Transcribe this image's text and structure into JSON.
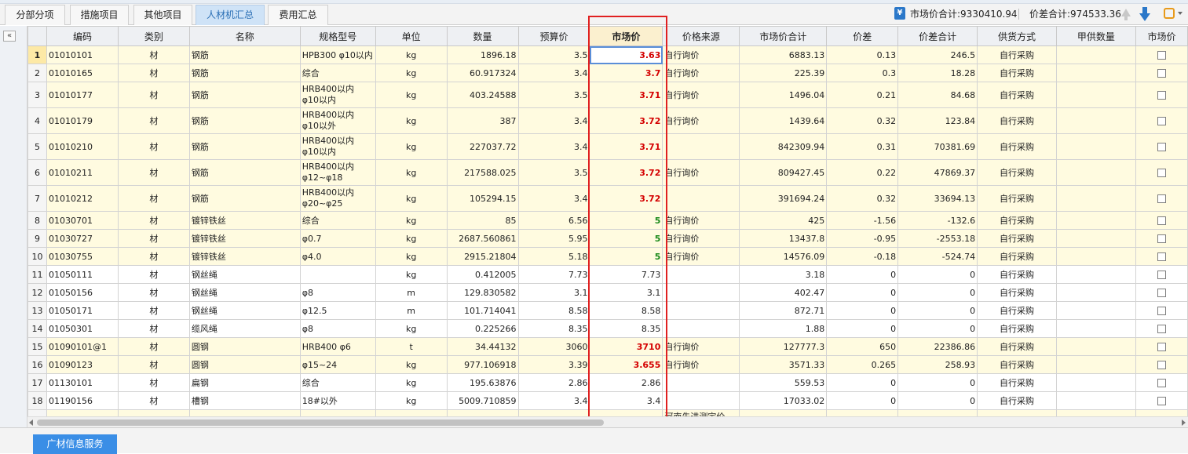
{
  "tabs": [
    {
      "label": "分部分项",
      "active": false
    },
    {
      "label": "措施项目",
      "active": false
    },
    {
      "label": "其他项目",
      "active": false
    },
    {
      "label": "人材机汇总",
      "active": true
    },
    {
      "label": "费用汇总",
      "active": false
    }
  ],
  "summary": {
    "market_total": "市场价合计:9330410.94",
    "diff_total": "价差合计:974533.36"
  },
  "icons": {
    "money": "money-icon",
    "move_up": "arrow-up-icon",
    "move_down": "arrow-down-icon",
    "settings": "settings-icon",
    "collapse": "collapse-left-icon"
  },
  "columns": [
    "编码",
    "类别",
    "名称",
    "规格型号",
    "单位",
    "数量",
    "预算价",
    "市场价",
    "价格来源",
    "市场价合计",
    "价差",
    "价差合计",
    "供货方式",
    "甲供数量",
    "市场价"
  ],
  "rows": [
    {
      "no": "1",
      "code": "01010101",
      "cat": "材",
      "name": "钢筋",
      "spec": "HPB300 φ10以内",
      "unit": "kg",
      "qty": "1896.18",
      "budget": "3.5",
      "market": "3.63",
      "source": "自行询价",
      "mtotal": "6883.13",
      "diff": "0.13",
      "dtotal": "246.5",
      "supply": "自行采购",
      "jia": ""
    },
    {
      "no": "2",
      "code": "01010165",
      "cat": "材",
      "name": "钢筋",
      "spec": "综合",
      "unit": "kg",
      "qty": "60.917324",
      "budget": "3.4",
      "market": "3.7",
      "source": "自行询价",
      "mtotal": "225.39",
      "diff": "0.3",
      "dtotal": "18.28",
      "supply": "自行采购",
      "jia": ""
    },
    {
      "no": "3",
      "code": "01010177",
      "cat": "材",
      "name": "钢筋",
      "spec": "HRB400以内 φ10以内",
      "unit": "kg",
      "qty": "403.24588",
      "budget": "3.5",
      "market": "3.71",
      "source": "自行询价",
      "mtotal": "1496.04",
      "diff": "0.21",
      "dtotal": "84.68",
      "supply": "自行采购",
      "jia": ""
    },
    {
      "no": "4",
      "code": "01010179",
      "cat": "材",
      "name": "钢筋",
      "spec": "HRB400以内 φ10以外",
      "unit": "kg",
      "qty": "387",
      "budget": "3.4",
      "market": "3.72",
      "source": "自行询价",
      "mtotal": "1439.64",
      "diff": "0.32",
      "dtotal": "123.84",
      "supply": "自行采购",
      "jia": ""
    },
    {
      "no": "5",
      "code": "01010210",
      "cat": "材",
      "name": "钢筋",
      "spec": "HRB400以内 φ10以内",
      "unit": "kg",
      "qty": "227037.72",
      "budget": "3.4",
      "market": "3.71",
      "source": "",
      "mtotal": "842309.94",
      "diff": "0.31",
      "dtotal": "70381.69",
      "supply": "自行采购",
      "jia": ""
    },
    {
      "no": "6",
      "code": "01010211",
      "cat": "材",
      "name": "钢筋",
      "spec": "HRB400以内 φ12~φ18",
      "unit": "kg",
      "qty": "217588.025",
      "budget": "3.5",
      "market": "3.72",
      "source": "自行询价",
      "mtotal": "809427.45",
      "diff": "0.22",
      "dtotal": "47869.37",
      "supply": "自行采购",
      "jia": ""
    },
    {
      "no": "7",
      "code": "01010212",
      "cat": "材",
      "name": "钢筋",
      "spec": "HRB400以内 φ20~φ25",
      "unit": "kg",
      "qty": "105294.15",
      "budget": "3.4",
      "market": "3.72",
      "source": "",
      "mtotal": "391694.24",
      "diff": "0.32",
      "dtotal": "33694.13",
      "supply": "自行采购",
      "jia": ""
    },
    {
      "no": "8",
      "code": "01030701",
      "cat": "材",
      "name": "镀锌铁丝",
      "spec": "综合",
      "unit": "kg",
      "qty": "85",
      "budget": "6.56",
      "market": "5",
      "source": "自行询价",
      "mtotal": "425",
      "diff": "-1.56",
      "dtotal": "-132.6",
      "supply": "自行采购",
      "jia": ""
    },
    {
      "no": "9",
      "code": "01030727",
      "cat": "材",
      "name": "镀锌铁丝",
      "spec": "φ0.7",
      "unit": "kg",
      "qty": "2687.560861",
      "budget": "5.95",
      "market": "5",
      "source": "自行询价",
      "mtotal": "13437.8",
      "diff": "-0.95",
      "dtotal": "-2553.18",
      "supply": "自行采购",
      "jia": ""
    },
    {
      "no": "10",
      "code": "01030755",
      "cat": "材",
      "name": "镀锌铁丝",
      "spec": "φ4.0",
      "unit": "kg",
      "qty": "2915.21804",
      "budget": "5.18",
      "market": "5",
      "source": "自行询价",
      "mtotal": "14576.09",
      "diff": "-0.18",
      "dtotal": "-524.74",
      "supply": "自行采购",
      "jia": ""
    },
    {
      "no": "11",
      "code": "01050111",
      "cat": "材",
      "name": "钢丝绳",
      "spec": "",
      "unit": "kg",
      "qty": "0.412005",
      "budget": "7.73",
      "market": "7.73",
      "source": "",
      "mtotal": "3.18",
      "diff": "0",
      "dtotal": "0",
      "supply": "自行采购",
      "jia": ""
    },
    {
      "no": "12",
      "code": "01050156",
      "cat": "材",
      "name": "钢丝绳",
      "spec": "φ8",
      "unit": "m",
      "qty": "129.830582",
      "budget": "3.1",
      "market": "3.1",
      "source": "",
      "mtotal": "402.47",
      "diff": "0",
      "dtotal": "0",
      "supply": "自行采购",
      "jia": ""
    },
    {
      "no": "13",
      "code": "01050171",
      "cat": "材",
      "name": "钢丝绳",
      "spec": "φ12.5",
      "unit": "m",
      "qty": "101.714041",
      "budget": "8.58",
      "market": "8.58",
      "source": "",
      "mtotal": "872.71",
      "diff": "0",
      "dtotal": "0",
      "supply": "自行采购",
      "jia": ""
    },
    {
      "no": "14",
      "code": "01050301",
      "cat": "材",
      "name": "缆风绳",
      "spec": "φ8",
      "unit": "kg",
      "qty": "0.225266",
      "budget": "8.35",
      "market": "8.35",
      "source": "",
      "mtotal": "1.88",
      "diff": "0",
      "dtotal": "0",
      "supply": "自行采购",
      "jia": ""
    },
    {
      "no": "15",
      "code": "01090101@1",
      "cat": "材",
      "name": "圆钢",
      "spec": "HRB400 φ6",
      "unit": "t",
      "qty": "34.44132",
      "budget": "3060",
      "market": "3710",
      "source": "自行询价",
      "mtotal": "127777.3",
      "diff": "650",
      "dtotal": "22386.86",
      "supply": "自行采购",
      "jia": ""
    },
    {
      "no": "16",
      "code": "01090123",
      "cat": "材",
      "name": "圆钢",
      "spec": "φ15~24",
      "unit": "kg",
      "qty": "977.106918",
      "budget": "3.39",
      "market": "3.655",
      "source": "自行询价",
      "mtotal": "3571.33",
      "diff": "0.265",
      "dtotal": "258.93",
      "supply": "自行采购",
      "jia": ""
    },
    {
      "no": "17",
      "code": "01130101",
      "cat": "材",
      "name": "扁钢",
      "spec": "综合",
      "unit": "kg",
      "qty": "195.63876",
      "budget": "2.86",
      "market": "2.86",
      "source": "",
      "mtotal": "559.53",
      "diff": "0",
      "dtotal": "0",
      "supply": "自行采购",
      "jia": ""
    },
    {
      "no": "18",
      "code": "01190156",
      "cat": "材",
      "name": "槽钢",
      "spec": "18#以外",
      "unit": "kg",
      "qty": "5009.710859",
      "budget": "3.4",
      "market": "3.4",
      "source": "",
      "mtotal": "17033.02",
      "diff": "0",
      "dtotal": "0",
      "supply": "自行采购",
      "jia": ""
    }
  ],
  "partial_row_source": "河南先进测定价",
  "bottom_button": "广材信息服务",
  "colors": {
    "accent": "#2b78c9",
    "red_text": "#d40000",
    "green_text": "#1a8a1a",
    "highlight_row": "#fffbe0",
    "red_box": "#e02020"
  }
}
